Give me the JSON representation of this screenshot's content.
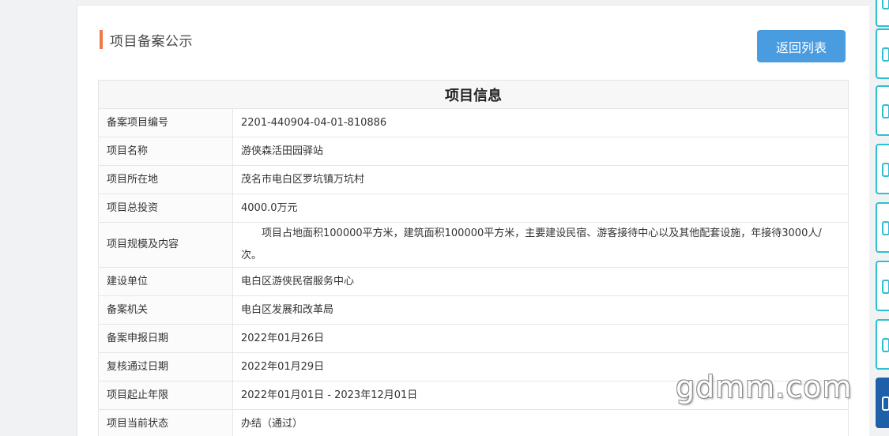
{
  "header": {
    "title": "项目备案公示",
    "back_button": "返回列表"
  },
  "table": {
    "heading": "项目信息",
    "rows": [
      {
        "label": "备案项目编号",
        "value": "2201-440904-04-01-810886"
      },
      {
        "label": "项目名称",
        "value": "游侠森活田园驿站"
      },
      {
        "label": "项目所在地",
        "value": "茂名市电白区罗坑镇万坑村"
      },
      {
        "label": "项目总投资",
        "value": "4000.0万元"
      },
      {
        "label": "项目规模及内容",
        "value": "项目占地面积100000平方米，建筑面积100000平方米，主要建设民宿、游客接待中心以及其他配套设施，年接待3000人/次。"
      },
      {
        "label": "建设单位",
        "value": "电白区游侠民宿服务中心"
      },
      {
        "label": "备案机关",
        "value": "电白区发展和改革局"
      },
      {
        "label": "备案申报日期",
        "value": "2022年01月26日"
      },
      {
        "label": "复核通过日期",
        "value": "2022年01月29日"
      },
      {
        "label": "项目起止年限",
        "value": "2022年01月01日 - 2023年12月01日"
      },
      {
        "label": "项目当前状态",
        "value": "办结（通过）"
      }
    ]
  },
  "watermark": "gdmm.com",
  "colors": {
    "accent_bar": "#f0784a",
    "button": "#4a9ce0",
    "sidebar_border": "#2cc0d0",
    "sidebar_dark": "#1d5fa8"
  },
  "sidebar_icons": [
    "user-icon",
    "phone-icon",
    "chat-icon",
    "share-icon",
    "edit-icon",
    "clock-icon",
    "menu-icon"
  ]
}
